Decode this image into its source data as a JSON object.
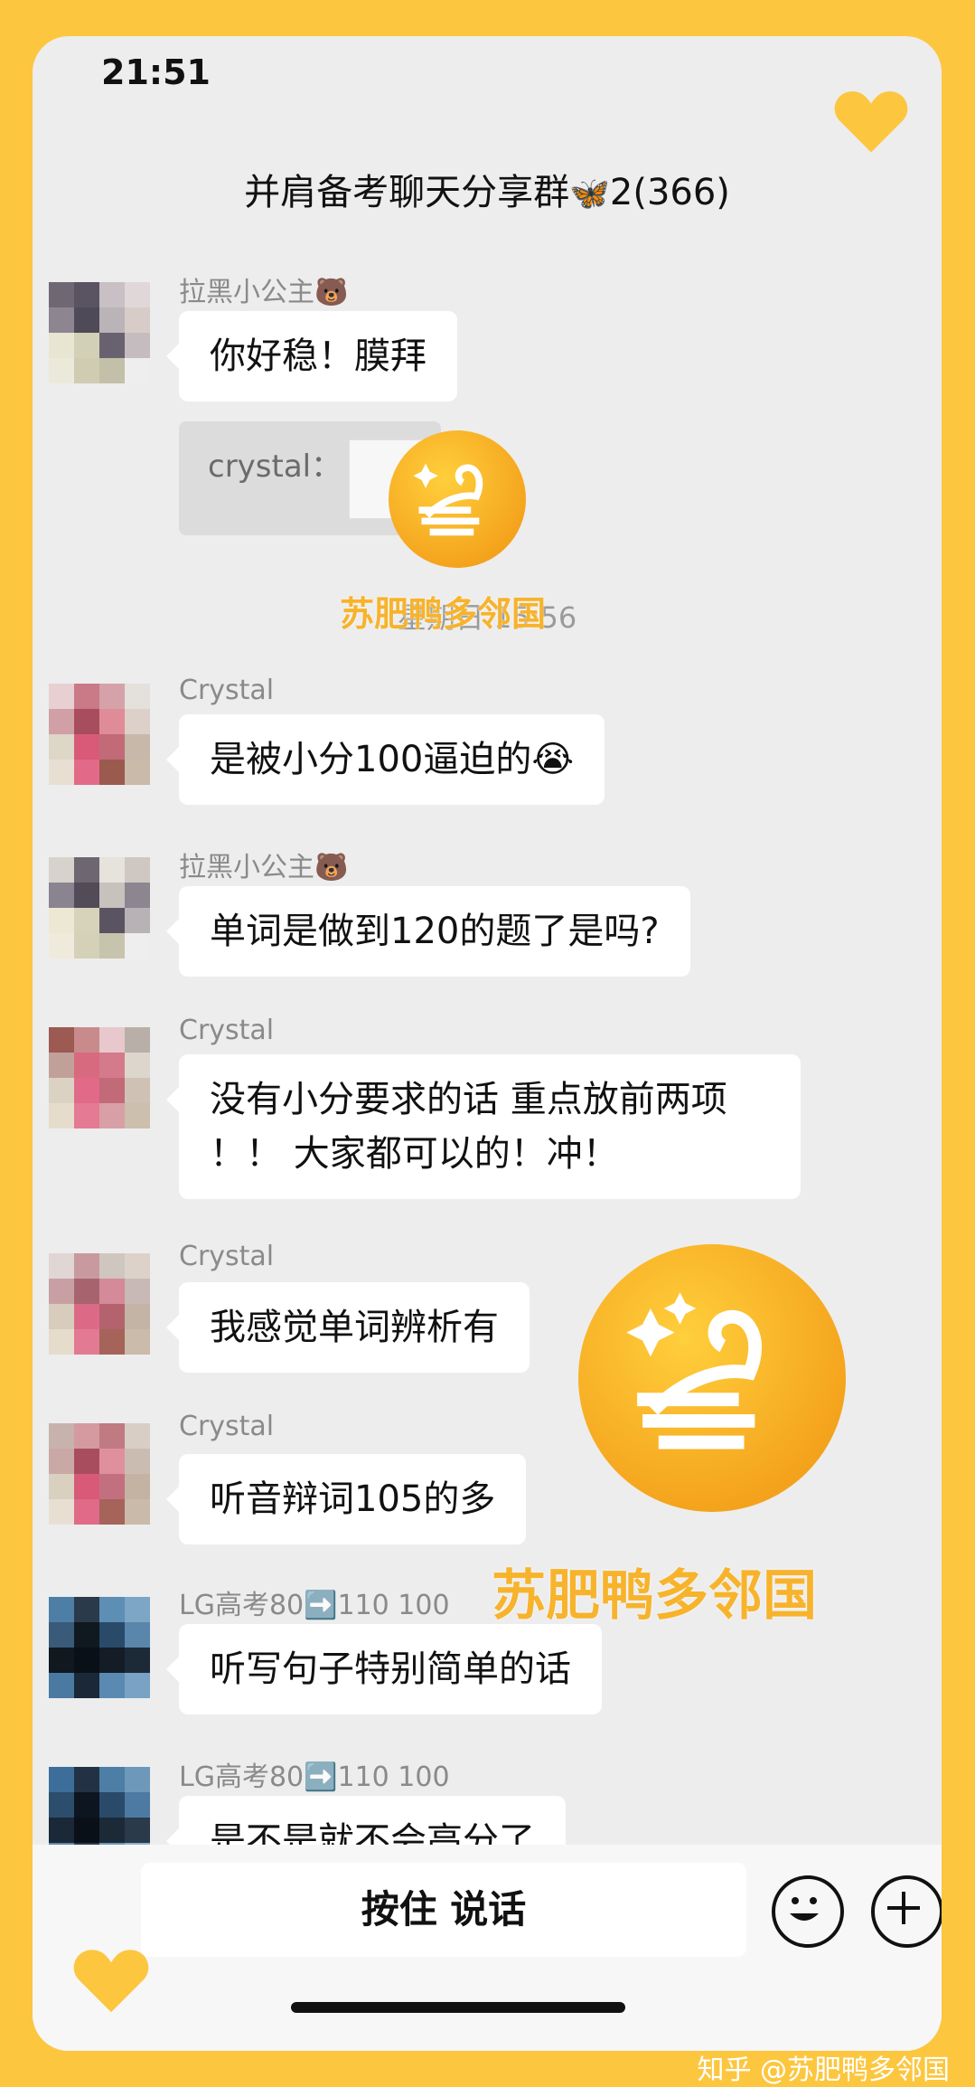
{
  "status_bar": {
    "time": "21:51"
  },
  "header": {
    "title": "并肩备考聊天分享群",
    "title_emoji": "🦋",
    "title_suffix": "2(366)"
  },
  "messages": [
    {
      "sender": "拉黑小公主🐻",
      "text": "你好稳！膜拜"
    },
    {
      "sender": "Crystal",
      "text": "是被小分100逼迫的😭"
    },
    {
      "sender": "拉黑小公主🐻",
      "text": "单词是做到120的题了是吗?"
    },
    {
      "sender": "Crystal",
      "text_line1": "没有小分要求的话 重点放前两项",
      "text_line2": "！！ 大家都可以的！冲！"
    },
    {
      "sender": "Crystal",
      "text": "我感觉单词辨析有"
    },
    {
      "sender": "Crystal",
      "text": "听音辩词105的多"
    },
    {
      "sender": "LG高考80➡️110 100",
      "text": "听写句子特别简单的话"
    },
    {
      "sender": "LG高考80➡️110 100",
      "text": "是不是就不会高分了"
    }
  ],
  "quote": {
    "text": "crystal："
  },
  "timestamp": "星期日 15:56",
  "watermark": {
    "text": "苏肥鸭多邻国",
    "footer": "知乎 @苏肥鸭多邻国"
  },
  "input_bar": {
    "voice_label": "按住 说话"
  },
  "colors": {
    "frame": "#fcc63f",
    "chat_bg": "#ededed",
    "bubble": "#ffffff",
    "watermark": "#f7b32b"
  },
  "icons": [
    "heart-icon",
    "swan-logo-icon",
    "emoji-icon",
    "plus-icon"
  ]
}
